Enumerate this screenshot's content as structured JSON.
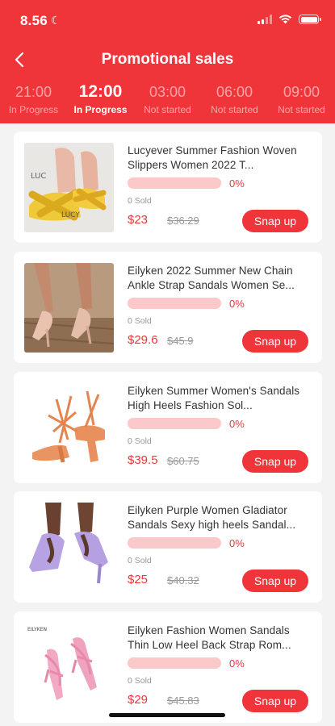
{
  "status_bar": {
    "time": "8.56",
    "icons": [
      "moon-icon",
      "signal-icon",
      "wifi-icon",
      "battery-icon"
    ]
  },
  "nav": {
    "back_icon": "chevron-left-icon",
    "title": "Promotional sales"
  },
  "tabs": [
    {
      "time": "21:00",
      "status": "In Progress",
      "active": false
    },
    {
      "time": "12:00",
      "status": "In Progress",
      "active": true
    },
    {
      "time": "03:00",
      "status": "Not started",
      "active": false
    },
    {
      "time": "06:00",
      "status": "Not started",
      "active": false
    },
    {
      "time": "09:00",
      "status": "Not started",
      "active": false
    }
  ],
  "products": [
    {
      "name": "Lucyever Summer Fashion Woven Slippers Women 2022 T...",
      "progress": 0,
      "percent": "0%",
      "sold": "0 Sold",
      "price": "$23",
      "original_price": "$36.29",
      "button": "Snap up"
    },
    {
      "name": "Eilyken 2022 Summer New Chain Ankle Strap Sandals Women Se...",
      "progress": 0,
      "percent": "0%",
      "sold": "0 Sold",
      "price": "$29.6",
      "original_price": "$45.9",
      "button": "Snap up"
    },
    {
      "name": "Eilyken Summer Women's Sandals High Heels Fashion Sol...",
      "progress": 0,
      "percent": "0%",
      "sold": "0 Sold",
      "price": "$39.5",
      "original_price": "$60.75",
      "button": "Snap up"
    },
    {
      "name": "Eilyken Purple Women Gladiator Sandals Sexy high heels Sandal...",
      "progress": 0,
      "percent": "0%",
      "sold": "0 Sold",
      "price": "$25",
      "original_price": "$40.32",
      "button": "Snap up"
    },
    {
      "name": "Eilyken Fashion Women Sandals Thin Low Heel Back Strap Rom...",
      "progress": 0,
      "percent": "0%",
      "sold": "0 Sold",
      "price": "$29",
      "original_price": "$45.83",
      "button": "Snap up"
    }
  ],
  "colors": {
    "accent": "#f0353a",
    "progress_track": "#fbc9ca",
    "background": "#f3f3f3"
  }
}
